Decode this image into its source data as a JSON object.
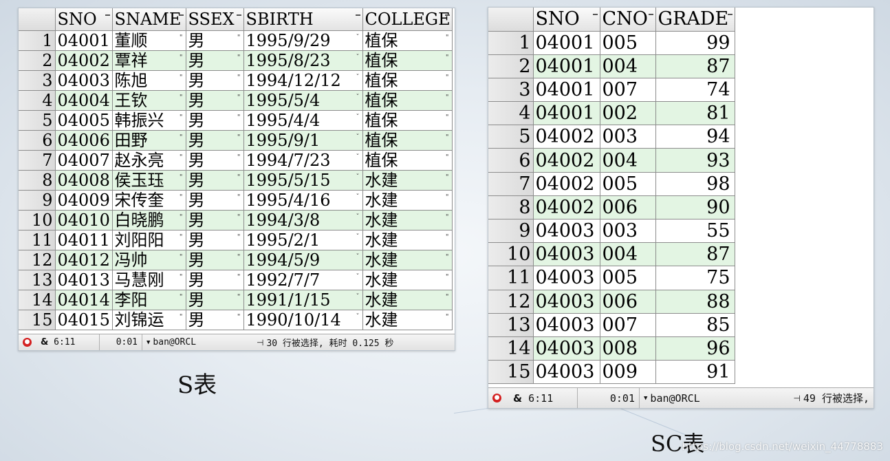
{
  "s_table": {
    "columns": [
      "SNO",
      "SNAME",
      "SSEX",
      "SBIRTH",
      "COLLEGE"
    ],
    "rows": [
      {
        "n": "1",
        "sno": "04001",
        "sname": "董顺",
        "ssex": "男",
        "sbirth": "1995/9/29",
        "college": "植保"
      },
      {
        "n": "2",
        "sno": "04002",
        "sname": "覃祥",
        "ssex": "男",
        "sbirth": "1995/8/23",
        "college": "植保"
      },
      {
        "n": "3",
        "sno": "04003",
        "sname": "陈旭",
        "ssex": "男",
        "sbirth": "1994/12/12",
        "college": "植保"
      },
      {
        "n": "4",
        "sno": "04004",
        "sname": "王钦",
        "ssex": "男",
        "sbirth": "1995/5/4",
        "college": "植保"
      },
      {
        "n": "5",
        "sno": "04005",
        "sname": "韩振兴",
        "ssex": "男",
        "sbirth": "1995/4/4",
        "college": "植保"
      },
      {
        "n": "6",
        "sno": "04006",
        "sname": "田野",
        "ssex": "男",
        "sbirth": "1995/9/1",
        "college": "植保"
      },
      {
        "n": "7",
        "sno": "04007",
        "sname": "赵永亮",
        "ssex": "男",
        "sbirth": "1994/7/23",
        "college": "植保"
      },
      {
        "n": "8",
        "sno": "04008",
        "sname": "侯玉珏",
        "ssex": "男",
        "sbirth": "1995/5/15",
        "college": "水建"
      },
      {
        "n": "9",
        "sno": "04009",
        "sname": "宋传奎",
        "ssex": "男",
        "sbirth": "1995/4/16",
        "college": "水建"
      },
      {
        "n": "10",
        "sno": "04010",
        "sname": "白晓鹏",
        "ssex": "男",
        "sbirth": "1994/3/8",
        "college": "水建"
      },
      {
        "n": "11",
        "sno": "04011",
        "sname": "刘阳阳",
        "ssex": "男",
        "sbirth": "1995/2/1",
        "college": "水建"
      },
      {
        "n": "12",
        "sno": "04012",
        "sname": "冯帅",
        "ssex": "男",
        "sbirth": "1994/5/9",
        "college": "水建"
      },
      {
        "n": "13",
        "sno": "04013",
        "sname": "马慧刚",
        "ssex": "男",
        "sbirth": "1992/7/7",
        "college": "水建"
      },
      {
        "n": "14",
        "sno": "04014",
        "sname": "李阳",
        "ssex": "男",
        "sbirth": "1991/1/15",
        "college": "水建"
      },
      {
        "n": "15",
        "sno": "04015",
        "sname": "刘锦运",
        "ssex": "男",
        "sbirth": "1990/10/14",
        "college": "水建"
      }
    ],
    "status": {
      "cursor_pos": "6:11",
      "elapsed": "0:01",
      "connection": "ban@ORCL",
      "message": "30 行被选择, 耗时 0.125 秒"
    },
    "caption": "S表"
  },
  "sc_table": {
    "columns": [
      "SNO",
      "CNO",
      "GRADE"
    ],
    "rows": [
      {
        "n": "1",
        "sno": "04001",
        "cno": "005",
        "grade": "99"
      },
      {
        "n": "2",
        "sno": "04001",
        "cno": "004",
        "grade": "87"
      },
      {
        "n": "3",
        "sno": "04001",
        "cno": "007",
        "grade": "74"
      },
      {
        "n": "4",
        "sno": "04001",
        "cno": "002",
        "grade": "81"
      },
      {
        "n": "5",
        "sno": "04002",
        "cno": "003",
        "grade": "94"
      },
      {
        "n": "6",
        "sno": "04002",
        "cno": "004",
        "grade": "93"
      },
      {
        "n": "7",
        "sno": "04002",
        "cno": "005",
        "grade": "98"
      },
      {
        "n": "8",
        "sno": "04002",
        "cno": "006",
        "grade": "90"
      },
      {
        "n": "9",
        "sno": "04003",
        "cno": "003",
        "grade": "55"
      },
      {
        "n": "10",
        "sno": "04003",
        "cno": "004",
        "grade": "87"
      },
      {
        "n": "11",
        "sno": "04003",
        "cno": "005",
        "grade": "75"
      },
      {
        "n": "12",
        "sno": "04003",
        "cno": "006",
        "grade": "88"
      },
      {
        "n": "13",
        "sno": "04003",
        "cno": "007",
        "grade": "85"
      },
      {
        "n": "14",
        "sno": "04003",
        "cno": "008",
        "grade": "96"
      },
      {
        "n": "15",
        "sno": "04003",
        "cno": "009",
        "grade": "91"
      }
    ],
    "status": {
      "cursor_pos": "6:11",
      "elapsed": "0:01",
      "connection": "ban@ORCL",
      "message": "49 行被选择,"
    },
    "caption": "SC表"
  },
  "watermark": "https://blog.csdn.net/weixin_44778883",
  "icons": {
    "status_stop": "stop-icon",
    "status_ampersand": "ampersand-icon",
    "status_connection": "dropdown-caret-icon",
    "status_message": "pin-icon"
  },
  "colors": {
    "alt_row": "#e3f5e3",
    "grid_line": "#8c8c8c",
    "stop_icon": "#d42020"
  }
}
